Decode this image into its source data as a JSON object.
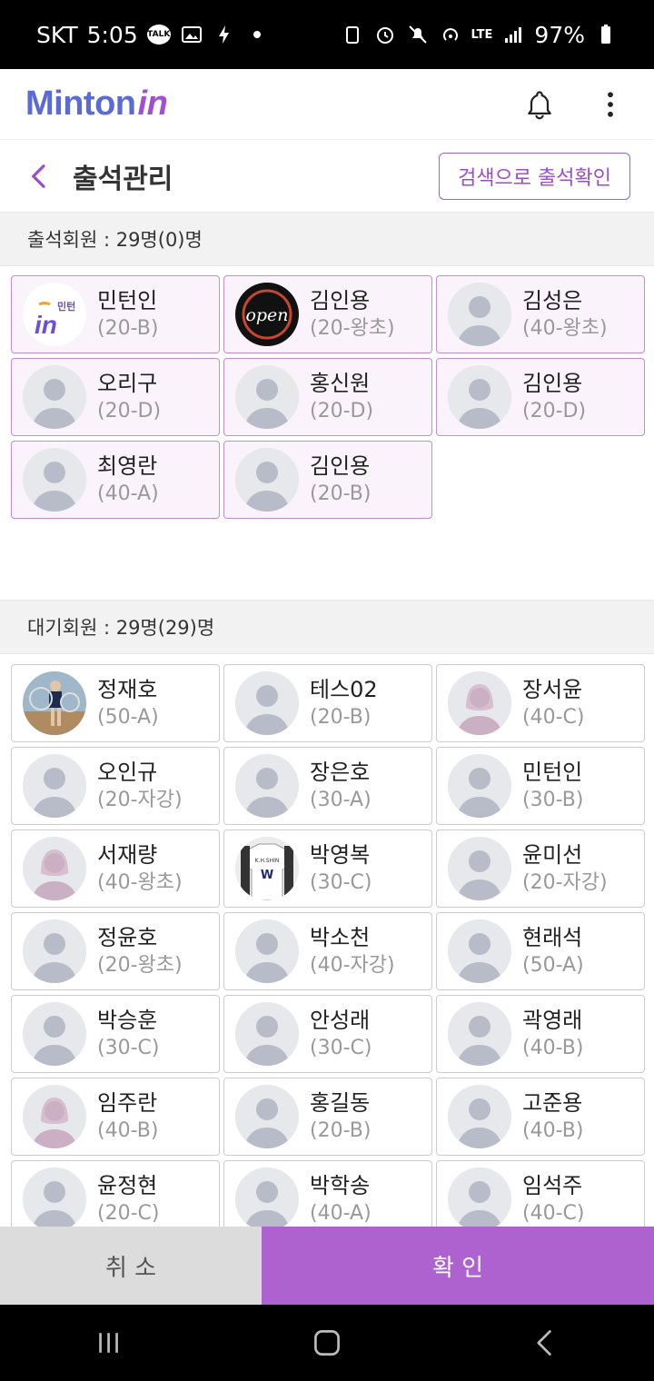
{
  "status_bar": {
    "carrier": "SKT",
    "time": "5:05",
    "talk_badge": "TALK",
    "battery": "97%",
    "network": "LTE"
  },
  "header": {
    "logo_text": "Minton",
    "logo_accent": "in"
  },
  "page": {
    "title": "출석관리",
    "search_button": "검색으로 출석확인"
  },
  "attended": {
    "heading": "출석회원 : 29명(0)명",
    "members": [
      {
        "name": "민턴인",
        "grade": "(20-B)",
        "avatar": "logo"
      },
      {
        "name": "김인용",
        "grade": "(20-왕초)",
        "avatar": "open"
      },
      {
        "name": "김성은",
        "grade": "(40-왕초)",
        "avatar": "male"
      },
      {
        "name": "오리구",
        "grade": "(20-D)",
        "avatar": "male"
      },
      {
        "name": "홍신원",
        "grade": "(20-D)",
        "avatar": "male"
      },
      {
        "name": "김인용",
        "grade": "(20-D)",
        "avatar": "male"
      },
      {
        "name": "최영란",
        "grade": "(40-A)",
        "avatar": "male"
      },
      {
        "name": "김인용",
        "grade": "(20-B)",
        "avatar": "male"
      }
    ]
  },
  "waiting": {
    "heading": "대기회원 : 29명(29)명",
    "members": [
      {
        "name": "정재호",
        "grade": "(50-A)",
        "avatar": "photo"
      },
      {
        "name": "테스02",
        "grade": "(20-B)",
        "avatar": "male"
      },
      {
        "name": "장서윤",
        "grade": "(40-C)",
        "avatar": "female"
      },
      {
        "name": "오인규",
        "grade": "(20-자강)",
        "avatar": "male"
      },
      {
        "name": "장은호",
        "grade": "(30-A)",
        "avatar": "male"
      },
      {
        "name": "민턴인",
        "grade": "(30-B)",
        "avatar": "male"
      },
      {
        "name": "서재량",
        "grade": "(40-왕초)",
        "avatar": "female"
      },
      {
        "name": "박영복",
        "grade": "(30-C)",
        "avatar": "shirt"
      },
      {
        "name": "윤미선",
        "grade": "(20-자강)",
        "avatar": "male"
      },
      {
        "name": "정윤호",
        "grade": "(20-왕초)",
        "avatar": "male"
      },
      {
        "name": "박소천",
        "grade": "(40-자강)",
        "avatar": "male"
      },
      {
        "name": "현래석",
        "grade": "(50-A)",
        "avatar": "male"
      },
      {
        "name": "박승훈",
        "grade": "(30-C)",
        "avatar": "male"
      },
      {
        "name": "안성래",
        "grade": "(30-C)",
        "avatar": "male"
      },
      {
        "name": "곽영래",
        "grade": "(40-B)",
        "avatar": "male"
      },
      {
        "name": "임주란",
        "grade": "(40-B)",
        "avatar": "female"
      },
      {
        "name": "홍길동",
        "grade": "(20-B)",
        "avatar": "male"
      },
      {
        "name": "고준용",
        "grade": "(40-B)",
        "avatar": "male"
      },
      {
        "name": "윤정현",
        "grade": "(20-C)",
        "avatar": "male"
      },
      {
        "name": "박학송",
        "grade": "(40-A)",
        "avatar": "male"
      },
      {
        "name": "임석주",
        "grade": "(40-C)",
        "avatar": "male"
      }
    ]
  },
  "footer": {
    "cancel": "취 소",
    "confirm": "확 인"
  },
  "colors": {
    "accent": "#ad62cf",
    "logo_blue": "#5b6bd6",
    "attended_bg": "#faf3fb",
    "attended_border": "#c78ad6"
  }
}
